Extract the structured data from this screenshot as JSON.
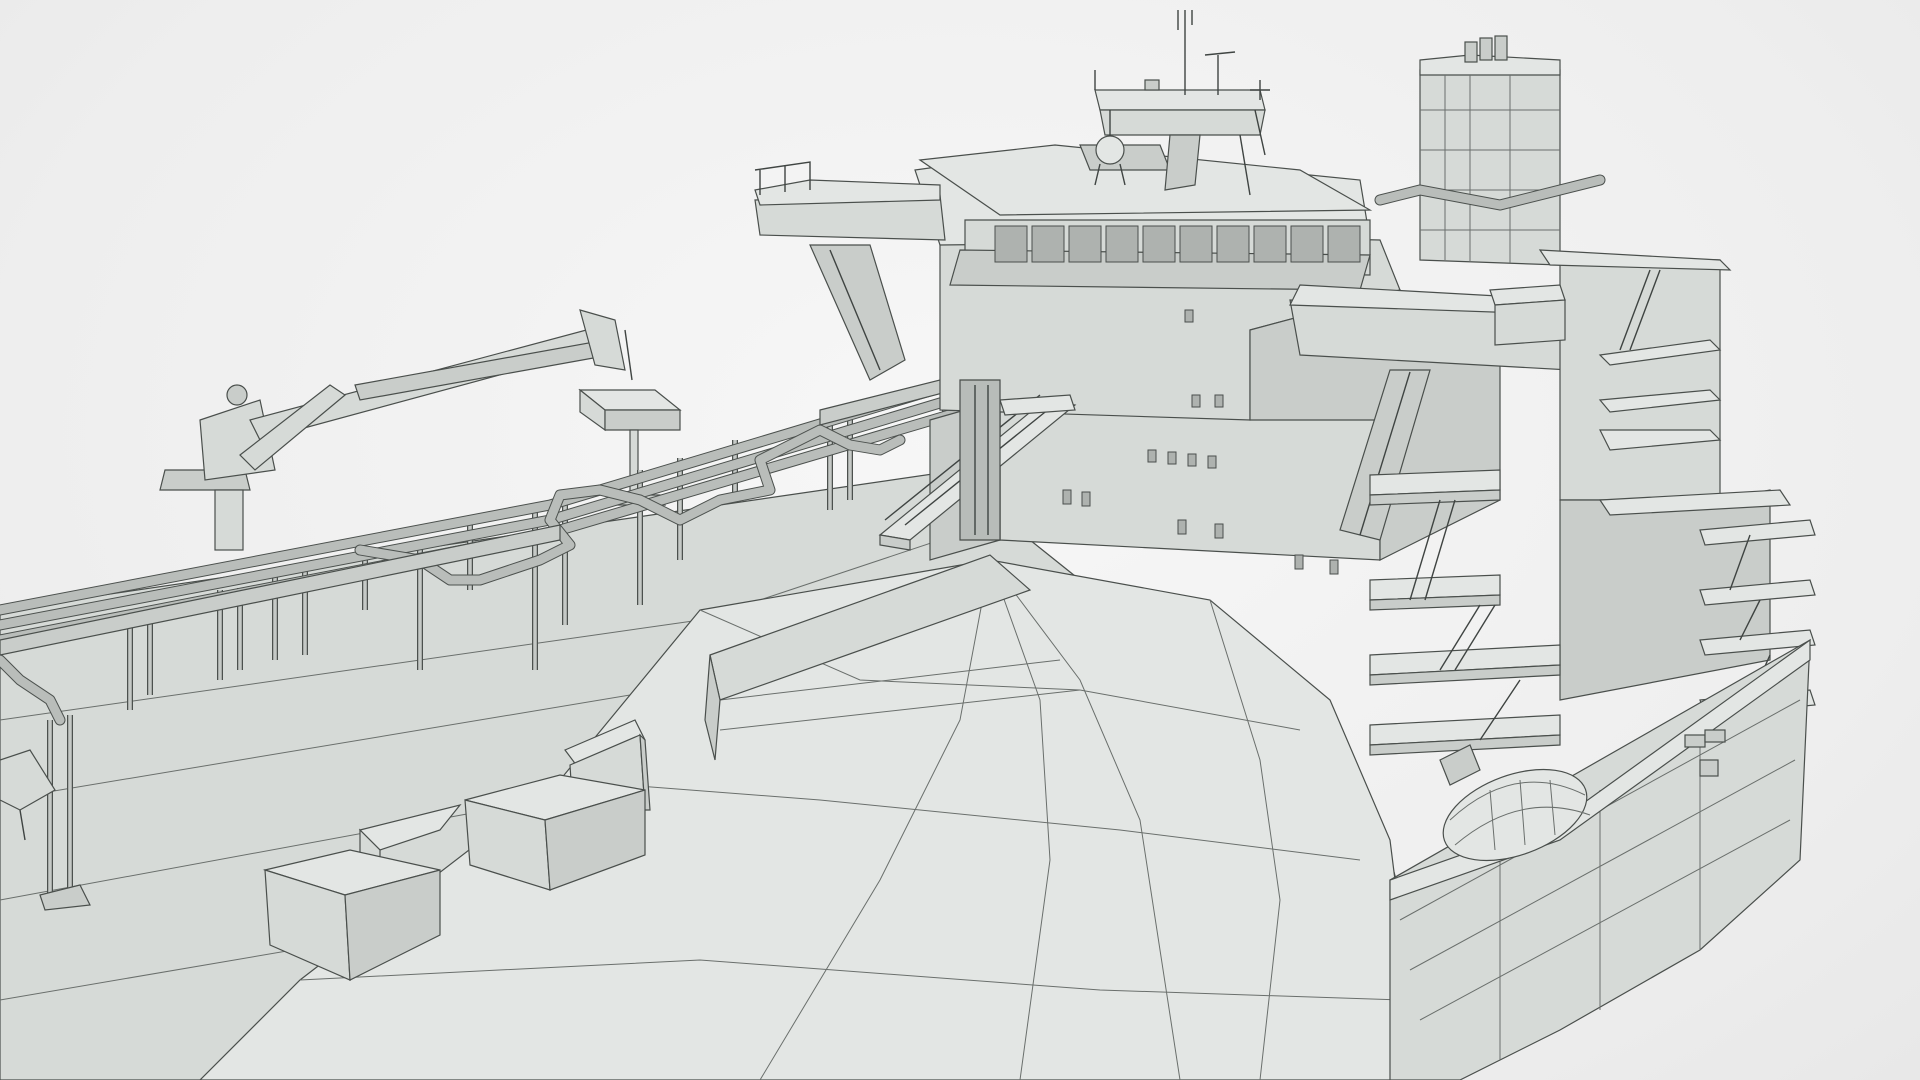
{
  "scene": {
    "background_color": "#f2f2f2",
    "model_color": "#cfd3d0",
    "edge_color": "#4a4f4c"
  }
}
